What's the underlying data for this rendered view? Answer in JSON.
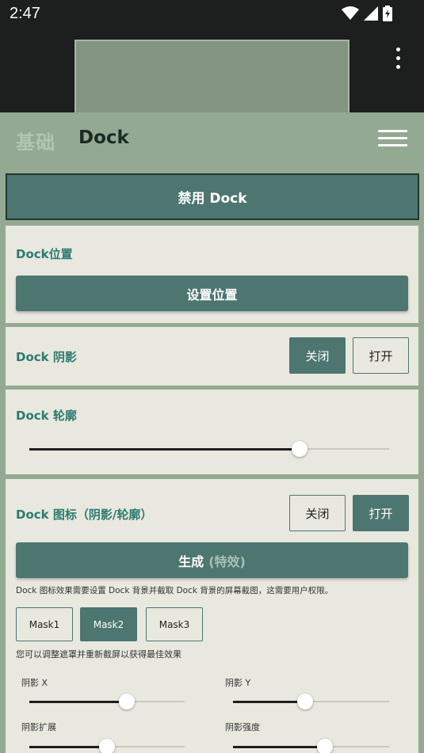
{
  "status": {
    "time": "2:47"
  },
  "header": {
    "tab_basic": "基础",
    "tab_dock": "Dock"
  },
  "disable_button": "禁用 Dock",
  "position_card": {
    "label": "Dock位置",
    "button": "设置位置"
  },
  "shadow_card": {
    "label": "Dock 阴影",
    "off": "关闭",
    "on": "打开",
    "selected": "off"
  },
  "outline_card": {
    "label": "Dock 轮廓",
    "value": 0.75
  },
  "icon_card": {
    "label": "Dock 图标（阴影/轮廓）",
    "off": "关闭",
    "on": "打开",
    "selected": "on",
    "generate": "生成",
    "generate_suffix": "(特效)",
    "note": "Dock 图标效果需要设置 Dock 背景并截取 Dock 背景的屏幕截图，这需要用户权限。",
    "masks": [
      "Mask1",
      "Mask2",
      "Mask3"
    ],
    "selected_mask": "Mask2",
    "mask_note": "您可以调整遮罩并重新截屏以获得最佳效果",
    "sliders": [
      {
        "label": "阴影 X",
        "value": 0.63
      },
      {
        "label": "阴影 Y",
        "value": 0.46
      },
      {
        "label": "阴影扩展",
        "value": 0.5
      },
      {
        "label": "阴影强度",
        "value": 0.59
      }
    ]
  },
  "colors": {
    "accent": "#4d7670",
    "card": "#e8e8df",
    "background": "#93a992",
    "label": "#2c7a6e"
  }
}
